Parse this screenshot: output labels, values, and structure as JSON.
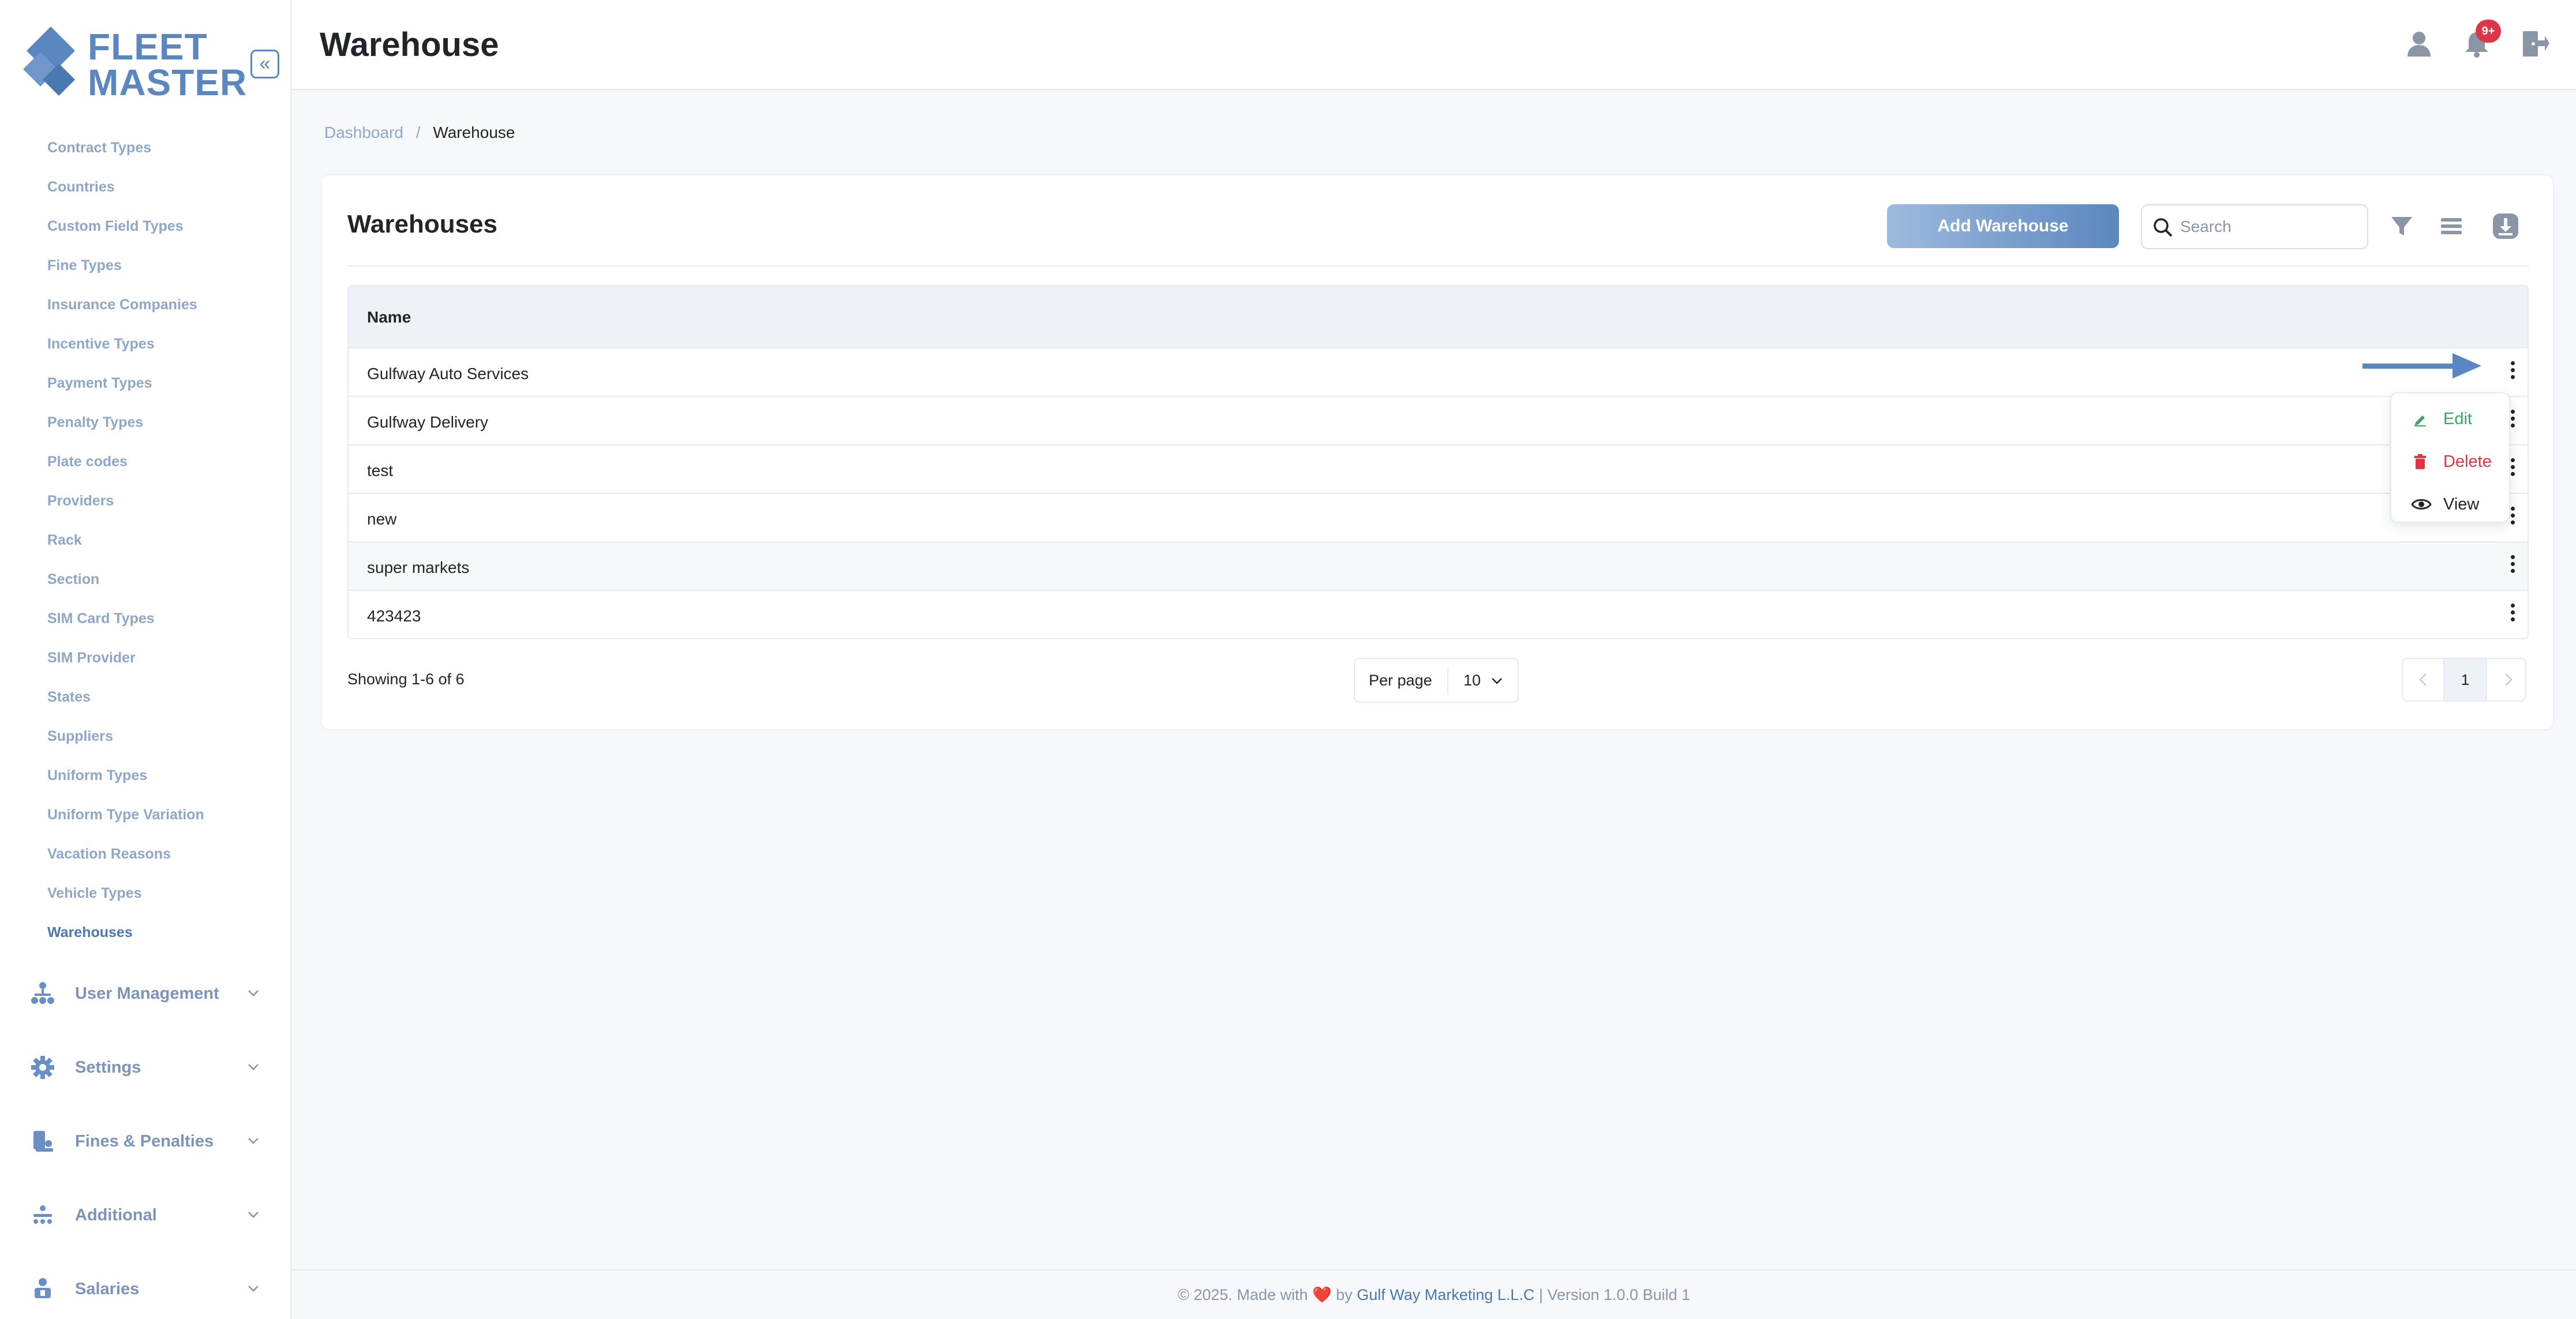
{
  "brand": {
    "line1": "FLEET",
    "line2": "MASTER"
  },
  "sidebar": {
    "collapse_label": "«",
    "sub_items": [
      {
        "label": "Contract Types"
      },
      {
        "label": "Countries"
      },
      {
        "label": "Custom Field Types"
      },
      {
        "label": "Fine Types"
      },
      {
        "label": "Insurance Companies"
      },
      {
        "label": "Incentive Types"
      },
      {
        "label": "Payment Types"
      },
      {
        "label": "Penalty Types"
      },
      {
        "label": "Plate codes"
      },
      {
        "label": "Providers"
      },
      {
        "label": "Rack"
      },
      {
        "label": "Section"
      },
      {
        "label": "SIM Card Types"
      },
      {
        "label": "SIM Provider"
      },
      {
        "label": "States"
      },
      {
        "label": "Suppliers"
      },
      {
        "label": "Uniform Types"
      },
      {
        "label": "Uniform Type Variation"
      },
      {
        "label": "Vacation Reasons"
      },
      {
        "label": "Vehicle Types"
      },
      {
        "label": "Warehouses"
      }
    ],
    "active_item": "Warehouses",
    "groups": [
      {
        "label": "User Management",
        "icon": "sitemap-icon"
      },
      {
        "label": "Settings",
        "icon": "gear-icon"
      },
      {
        "label": "Fines & Penalties",
        "icon": "fines-icon"
      },
      {
        "label": "Additional",
        "icon": "additional-icon"
      },
      {
        "label": "Salaries",
        "icon": "salaries-icon"
      }
    ]
  },
  "header": {
    "title": "Warehouse",
    "notification_badge": "9+",
    "icons": [
      "user-icon",
      "bell-icon",
      "logout-icon"
    ]
  },
  "breadcrumb": {
    "home": "Dashboard",
    "separator": "/",
    "current": "Warehouse"
  },
  "card": {
    "title": "Warehouses",
    "add_button": "Add Warehouse",
    "search": {
      "placeholder": "Search",
      "value": ""
    },
    "tools": [
      "filter-icon",
      "columns-icon",
      "download-icon"
    ]
  },
  "table": {
    "columns": [
      "Name"
    ],
    "rows": [
      {
        "name": "Gulfway Auto Services"
      },
      {
        "name": "Gulfway Delivery"
      },
      {
        "name": "test"
      },
      {
        "name": "new"
      },
      {
        "name": "super markets"
      },
      {
        "name": "423423"
      }
    ]
  },
  "row_menu": {
    "items": [
      {
        "label": "Edit",
        "icon": "pencil-icon",
        "color": "#3aa66a"
      },
      {
        "label": "Delete",
        "icon": "trash-icon",
        "color": "#dc3545"
      },
      {
        "label": "View",
        "icon": "eye-icon",
        "color": "#212529"
      }
    ]
  },
  "pagination": {
    "showing": "Showing 1-6 of 6",
    "per_page_label": "Per page",
    "per_page_value": "10",
    "current_page": "1"
  },
  "footer": {
    "prefix": "© 2025. Made with",
    "heart": "❤️",
    "by": "by",
    "company": "Gulf Way Marketing L.L.C",
    "version": "| Version 1.0.0 Build 1"
  },
  "colors": {
    "accent": "#5b87c0",
    "danger": "#dc3545",
    "success": "#3aa66a"
  }
}
